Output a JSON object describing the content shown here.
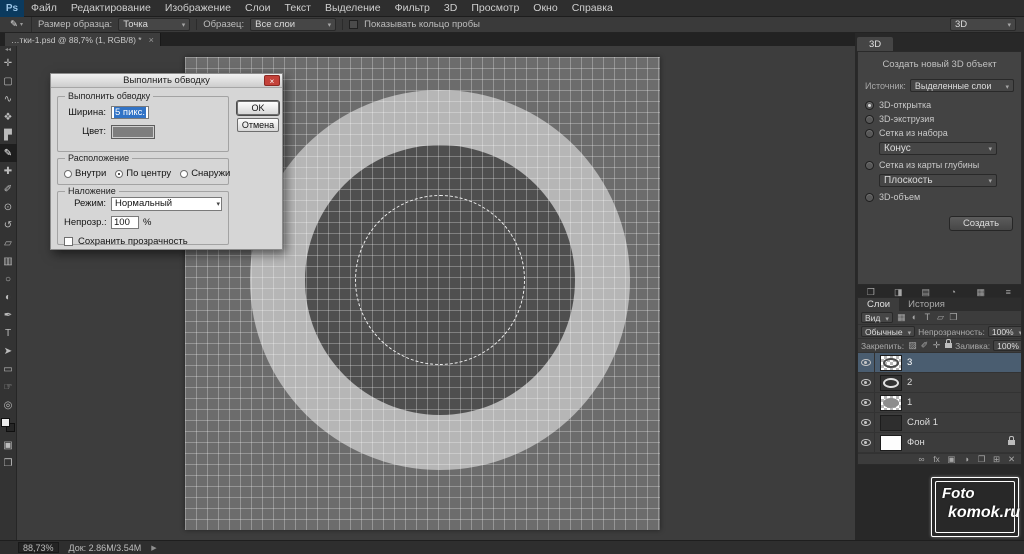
{
  "colors": {
    "selection_blue": "#3173c6",
    "layer_selected_row": "#4a5d70",
    "canvas_gray": "#6c6c6c",
    "ring_light_gray": "#b6b6b6",
    "inner_disc_gray": "#4f4f4f"
  },
  "icons": {
    "chevron_down": "▾"
  },
  "menu": {
    "logo": "Ps",
    "items": [
      {
        "label": "Файл"
      },
      {
        "label": "Редактирование"
      },
      {
        "label": "Изображение"
      },
      {
        "label": "Слои"
      },
      {
        "label": "Текст"
      },
      {
        "label": "Выделение"
      },
      {
        "label": "Фильтр"
      },
      {
        "label": "3D"
      },
      {
        "label": "Просмотр"
      },
      {
        "label": "Окно"
      },
      {
        "label": "Справка"
      }
    ]
  },
  "options_bar": {
    "tool_icon": "✎",
    "sample_size_label": "Размер образца:",
    "sample_size_value": "Точка",
    "sample_label": "Образец:",
    "sample_value": "Все слои",
    "show_ring_label": "Показывать кольцо пробы",
    "workspace_value": "3D"
  },
  "document_tab": {
    "title": "…тки-1.psd @ 88,7% (1, RGB/8) *",
    "close": "×"
  },
  "toolbar": {
    "collapse": "◂◂",
    "tools": [
      {
        "name": "move-tool-icon",
        "glyph": "✛"
      },
      {
        "name": "marquee-tool-icon",
        "glyph": "▢"
      },
      {
        "name": "lasso-tool-icon",
        "glyph": "∿"
      },
      {
        "name": "quick-selection-tool-icon",
        "glyph": "❖"
      },
      {
        "name": "crop-tool-icon",
        "glyph": "▛"
      },
      {
        "name": "eyedropper-tool-icon",
        "glyph": "✎",
        "active": true
      },
      {
        "name": "healing-brush-tool-icon",
        "glyph": "✚"
      },
      {
        "name": "brush-tool-icon",
        "glyph": "✐"
      },
      {
        "name": "clone-stamp-tool-icon",
        "glyph": "⊙"
      },
      {
        "name": "history-brush-tool-icon",
        "glyph": "↺"
      },
      {
        "name": "eraser-tool-icon",
        "glyph": "▱"
      },
      {
        "name": "gradient-tool-icon",
        "glyph": "▥"
      },
      {
        "name": "blur-tool-icon",
        "glyph": "○"
      },
      {
        "name": "dodge-tool-icon",
        "glyph": "◐"
      },
      {
        "name": "pen-tool-icon",
        "glyph": "✒"
      },
      {
        "name": "type-tool-icon",
        "glyph": "T"
      },
      {
        "name": "path-selection-tool-icon",
        "glyph": "➤"
      },
      {
        "name": "shape-tool-icon",
        "glyph": "▭"
      },
      {
        "name": "hand-tool-icon",
        "glyph": "☞"
      },
      {
        "name": "zoom-tool-icon",
        "glyph": "◎"
      }
    ],
    "bottom_icons": [
      {
        "name": "quick-mask-icon",
        "glyph": "▣"
      },
      {
        "name": "screen-mode-icon",
        "glyph": "❐"
      }
    ]
  },
  "dialog": {
    "title": "Выполнить обводку",
    "close": "×",
    "stroke_group": "Выполнить обводку",
    "width_label": "Ширина:",
    "width_value": "5 пикс.",
    "color_label": "Цвет:",
    "location_group": "Расположение",
    "location_options": [
      {
        "label": "Внутри"
      },
      {
        "label": "По центру",
        "checked": true
      },
      {
        "label": "Снаружи"
      }
    ],
    "blend_group": "Наложение",
    "mode_label": "Режим:",
    "mode_value": "Нормальный",
    "opacity_label": "Непрозр.:",
    "opacity_value": "100",
    "percent": "%",
    "preserve_label": "Сохранить прозрачность",
    "ok": "OK",
    "cancel": "Отмена"
  },
  "panel3d": {
    "tab": "3D",
    "title": "Создать новый 3D объект",
    "source_label": "Источник:",
    "source_value": "Выделенные слои",
    "options": [
      {
        "label": "3D-открытка",
        "checked": true
      },
      {
        "label": "3D-экструзия"
      },
      {
        "label": "Сетка из набора",
        "select": "Конус"
      },
      {
        "label": "Сетка из карты глубины",
        "select": "Плоскость"
      },
      {
        "label": "3D-объем"
      }
    ],
    "create_button": "Создать"
  },
  "dock_strip": {
    "icons": [
      {
        "name": "dock-panel-icon",
        "glyph": "❒"
      },
      {
        "name": "dock-panel-icon",
        "glyph": "◨"
      },
      {
        "name": "dock-panel-icon",
        "glyph": "▤"
      },
      {
        "name": "dock-panel-icon",
        "glyph": "◔"
      },
      {
        "name": "dock-panel-icon",
        "glyph": "▦"
      },
      {
        "name": "dock-panel-icon",
        "glyph": "≡"
      }
    ]
  },
  "layers": {
    "tabs": [
      {
        "label": "Слои"
      },
      {
        "label": "История"
      }
    ],
    "filter_label": "Вид",
    "filter_icons": [
      {
        "name": "filter-pixel-layers-icon",
        "glyph": "▦"
      },
      {
        "name": "filter-adjustment-layers-icon",
        "glyph": "◐"
      },
      {
        "name": "filter-type-layers-icon",
        "glyph": "T"
      },
      {
        "name": "filter-shape-layers-icon",
        "glyph": "▱"
      },
      {
        "name": "filter-smart-object-icon",
        "glyph": "❒"
      }
    ],
    "blend_mode": "Обычные",
    "opacity_label": "Непрозрачность:",
    "opacity_value": "100%",
    "lock_label": "Закрепить:",
    "lock_icons": [
      {
        "name": "lock-transparent-pixels-icon",
        "glyph": "▨"
      },
      {
        "name": "lock-image-pixels-icon",
        "glyph": "✐"
      },
      {
        "name": "lock-position-icon",
        "glyph": "✛"
      }
    ],
    "fill_label": "Заливка:",
    "fill_value": "100%",
    "rows": [
      {
        "name": "3",
        "thumb": "thumb-checker-ring",
        "checker": true,
        "selected": true
      },
      {
        "name": "2",
        "thumb": "thumb-dark-ring"
      },
      {
        "name": "1",
        "thumb": "thumb-checker-disc",
        "checker": true
      },
      {
        "name": "Слой 1",
        "thumb": "thumb-dark"
      },
      {
        "name": "Фон",
        "thumb": "thumb-white",
        "locked": true
      }
    ],
    "bottom_icons": [
      {
        "name": "link-layers-icon",
        "glyph": "∞"
      },
      {
        "name": "layer-style-icon",
        "glyph": "fx"
      },
      {
        "name": "add-layer-mask-icon",
        "glyph": "▣"
      },
      {
        "name": "adjustment-layer-icon",
        "glyph": "◑"
      },
      {
        "name": "group-layers-icon",
        "glyph": "❐"
      },
      {
        "name": "new-layer-icon",
        "glyph": "⊞"
      },
      {
        "name": "delete-layer-icon",
        "glyph": "✕"
      }
    ]
  },
  "status_bar": {
    "zoom": "88,73%",
    "doc": "Док: 2.86M/3.54M",
    "arrow": "▶"
  },
  "watermark": {
    "line1": "Foto",
    "line2": "komok.ru"
  }
}
